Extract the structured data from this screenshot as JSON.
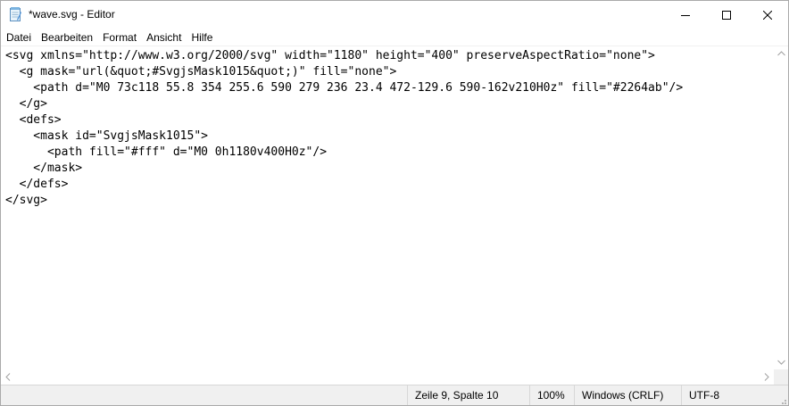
{
  "window": {
    "title": "*wave.svg - Editor"
  },
  "menu": {
    "items": [
      "Datei",
      "Bearbeiten",
      "Format",
      "Ansicht",
      "Hilfe"
    ]
  },
  "editor": {
    "lines": [
      "<svg xmlns=\"http://www.w3.org/2000/svg\" width=\"1180\" height=\"400\" preserveAspectRatio=\"none\">",
      "  <g mask=\"url(&quot;#SvgjsMask1015&quot;)\" fill=\"none\">",
      "    <path d=\"M0 73c118 55.8 354 255.6 590 279 236 23.4 472-129.6 590-162v210H0z\" fill=\"#2264ab\"/>",
      "  </g>",
      "  <defs>",
      "    <mask id=\"SvgjsMask1015\">",
      "      <path fill=\"#fff\" d=\"M0 0h1180v400H0z\"/>",
      "    </mask>",
      "  </defs>",
      "</svg>"
    ]
  },
  "statusbar": {
    "position": "Zeile 9, Spalte 10",
    "zoom": "100%",
    "line_endings": "Windows (CRLF)",
    "encoding": "UTF-8"
  },
  "icons": {
    "app": "notepad-icon",
    "minimize": "minimize-icon",
    "maximize": "maximize-icon",
    "close": "close-icon"
  }
}
